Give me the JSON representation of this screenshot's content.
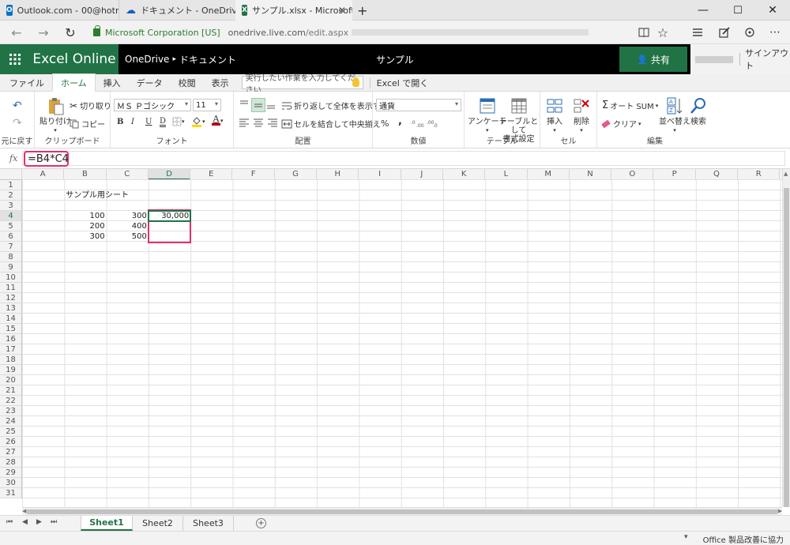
{
  "browser": {
    "tabs": [
      {
        "label": "Outlook.com - ",
        "label_suffix": "00@hotr"
      },
      {
        "label": "ドキュメント - OneDrive"
      },
      {
        "label": "サンプル.xlsx - Microsoft E"
      }
    ],
    "window_controls": {
      "minimize": "—",
      "maximize": "☐",
      "close": "✕"
    },
    "url_identity": "Microsoft Corporation [US]",
    "url_host": "onedrive.live.com",
    "url_path": "/edit.aspx",
    "nav": {
      "back": "←",
      "forward": "→",
      "refresh": "↻"
    }
  },
  "excel_header": {
    "brand": "Excel Online",
    "breadcrumb_root": "OneDrive",
    "breadcrumb_sep": "▸",
    "breadcrumb_folder": "ドキュメント",
    "doc_title": "サンプル",
    "share_label": "共有",
    "signout_label": "サインアウト"
  },
  "ribbon_tabs": [
    "ファイル",
    "ホーム",
    "挿入",
    "データ",
    "校閲",
    "表示"
  ],
  "tell_me_placeholder": "実行したい作業を入力してください",
  "open_in_excel": "Excel で開く",
  "ribbon": {
    "undo_group": "元に戻す",
    "paste": "貼り付け",
    "cut": "切り取り",
    "copy": "コピー",
    "clipboard_group": "クリップボード",
    "font_name": "ＭＳ Ｐゴシック",
    "font_size": "11",
    "bold": "B",
    "italic": "I",
    "underline": "U",
    "double_underline": "D",
    "font_group": "フォント",
    "wrap_text": "折り返して全体を表示する",
    "merge_center": "セルを結合して中央揃え",
    "alignment_group": "配置",
    "number_format": "通貨",
    "percent": "%",
    "comma": ",",
    "number_group": "数値",
    "survey": "アンケート",
    "format_table_line1": "テーブルとして",
    "format_table_line2": "書式設定",
    "table_group": "テーブル",
    "insert": "挿入",
    "delete": "削除",
    "cells_group": "セル",
    "autosum": "オート SUM",
    "clear": "クリア",
    "sort": "並べ替え",
    "find": "検索",
    "editing_group": "編集"
  },
  "formula_bar": {
    "fx": "fx",
    "formula": "=B4*C4"
  },
  "sheet": {
    "columns": [
      "A",
      "B",
      "C",
      "D",
      "E",
      "F",
      "G",
      "H",
      "I",
      "J",
      "K",
      "L",
      "M",
      "N",
      "O",
      "P",
      "Q",
      "R"
    ],
    "active_column": "D",
    "rows": 31,
    "active_row": 4,
    "cells": [
      {
        "ref": "B2",
        "col": "B",
        "row": 2,
        "value": "サンプル用シート",
        "align": "left"
      },
      {
        "ref": "B4",
        "col": "B",
        "row": 4,
        "value": "100",
        "align": "right"
      },
      {
        "ref": "C4",
        "col": "C",
        "row": 4,
        "value": "300",
        "align": "right"
      },
      {
        "ref": "D4",
        "col": "D",
        "row": 4,
        "value": "30,000",
        "align": "right"
      },
      {
        "ref": "B5",
        "col": "B",
        "row": 5,
        "value": "200",
        "align": "right"
      },
      {
        "ref": "C5",
        "col": "C",
        "row": 5,
        "value": "400",
        "align": "right"
      },
      {
        "ref": "B6",
        "col": "B",
        "row": 6,
        "value": "300",
        "align": "right"
      },
      {
        "ref": "C6",
        "col": "C",
        "row": 6,
        "value": "500",
        "align": "right"
      }
    ],
    "selected_cell": "D4",
    "highlight_range": "D4:D6"
  },
  "sheet_tabs": [
    "Sheet1",
    "Sheet2",
    "Sheet3"
  ],
  "active_sheet": "Sheet1",
  "sheet_nav": [
    "⏮",
    "◀",
    "▶",
    "⏭"
  ],
  "status": "Office 製品改善に協力",
  "colors": {
    "excel_green": "#217346",
    "highlight": "#e0306e"
  }
}
